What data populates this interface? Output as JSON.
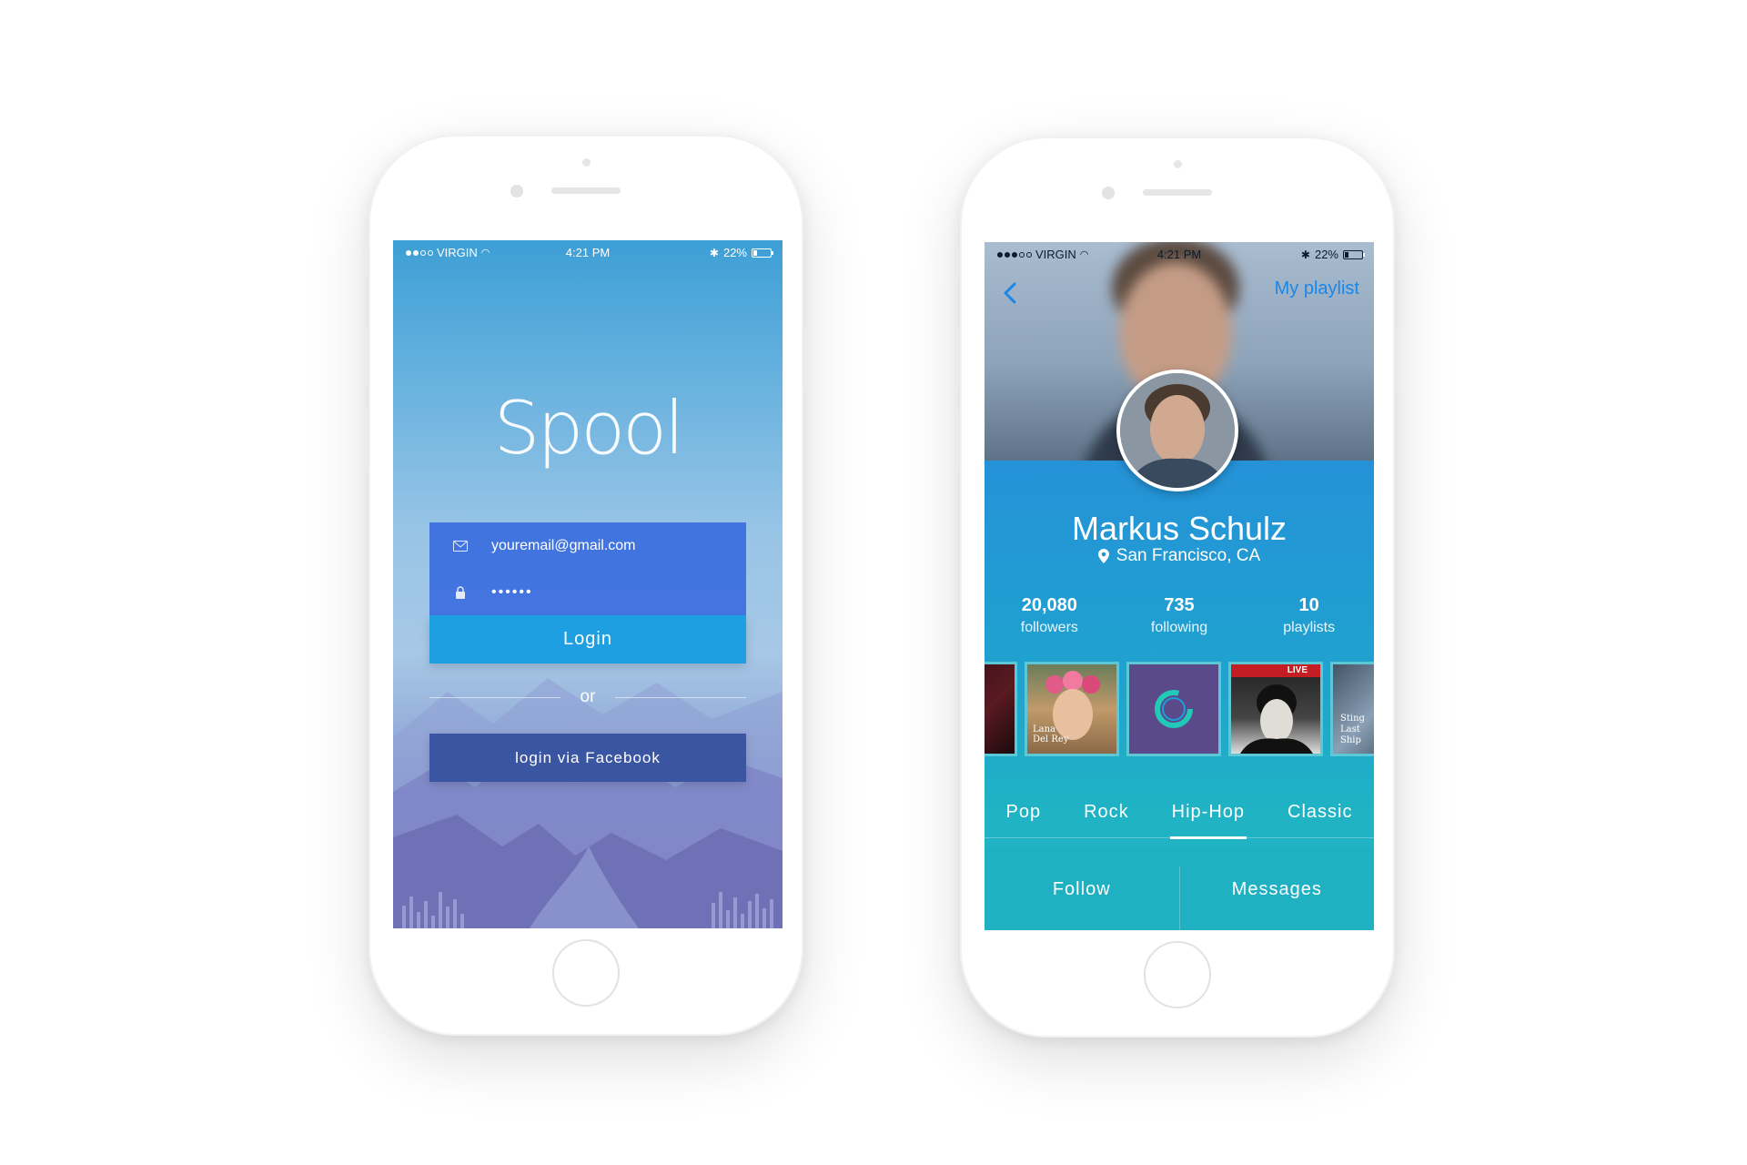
{
  "status_bar": {
    "carrier": "VIRGIN",
    "time": "4:21 PM",
    "battery": "22%",
    "battery_level": 0.22
  },
  "login_screen": {
    "logo": "Spool",
    "email_value": "youremail@gmail.com",
    "password_value": "••••••",
    "login_label": "Login",
    "or_label": "or",
    "facebook_label": "login via Facebook",
    "icons": {
      "email": "mail-icon",
      "password": "lock-icon"
    },
    "colors": {
      "fields": "#3b6cde",
      "login_button": "#1d9fe1",
      "facebook_button": "#3a56a3"
    }
  },
  "profile_screen": {
    "back_icon": "chevron-left-icon",
    "playlist_link": "My playlist",
    "name": "Markus Schulz",
    "location": "San Francisco, CA",
    "stats": [
      {
        "value": "20,080",
        "label": "followers"
      },
      {
        "value": "735",
        "label": "following"
      },
      {
        "value": "10",
        "label": "playlists"
      }
    ],
    "albums": [
      {
        "name": "dark-album-cover"
      },
      {
        "name": "lana-del-rey-album-cover",
        "text": "Lana Del Rey"
      },
      {
        "name": "circle-logo-album-cover"
      },
      {
        "name": "bob-dylan-live-album-cover",
        "text": "LIVE"
      },
      {
        "name": "sting-album-cover",
        "text": "Sting Last Ship"
      }
    ],
    "tabs": [
      {
        "label": "Pop",
        "active": false
      },
      {
        "label": "Rock",
        "active": false
      },
      {
        "label": "Hip-Hop",
        "active": true
      },
      {
        "label": "Classic",
        "active": false
      }
    ],
    "follow_label": "Follow",
    "messages_label": "Messages",
    "colors": {
      "accent": "#1a86e8",
      "panel": "#1fb0c2"
    }
  }
}
